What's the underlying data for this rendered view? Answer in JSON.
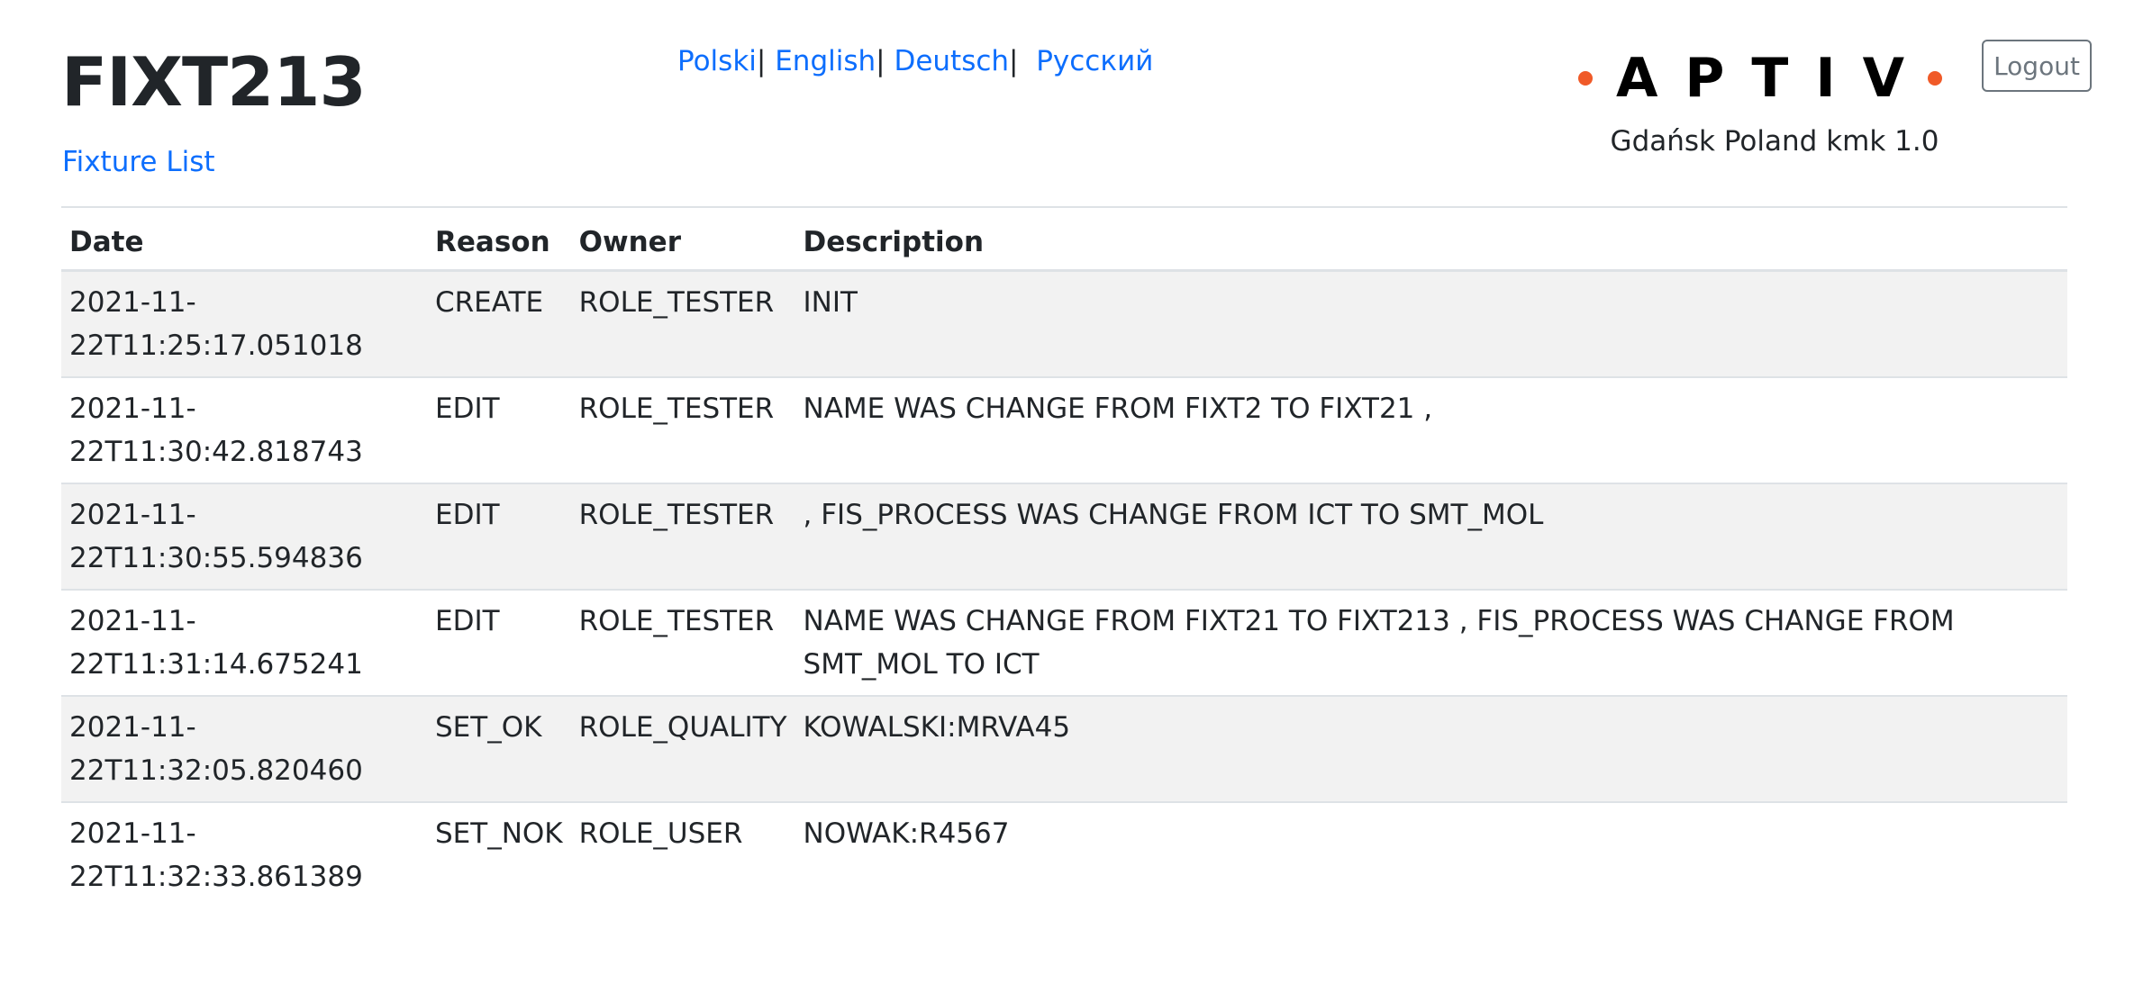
{
  "header": {
    "title": "FIXT213",
    "fixture_list_link": "Fixture List",
    "languages": [
      {
        "label": "Polski"
      },
      {
        "label": "English"
      },
      {
        "label": "Deutsch"
      },
      {
        "label": "Русский"
      }
    ],
    "language_separator": "|",
    "logo_text": "APTIV",
    "site_info": "Gdańsk Poland kmk 1.0",
    "logout_label": "Logout"
  },
  "colors": {
    "link": "#0d6efd",
    "logo_dot": "#f05a28",
    "striped_row": "#f2f2f2",
    "border": "#dee2e6"
  },
  "table": {
    "columns": [
      "Date",
      "Reason",
      "Owner",
      "Description"
    ],
    "rows": [
      {
        "date_line1": "2021-11-",
        "date_line2": "22T11:25:17.051018",
        "reason": "CREATE",
        "owner": "ROLE_TESTER",
        "description": "INIT"
      },
      {
        "date_line1": "2021-11-",
        "date_line2": "22T11:30:42.818743",
        "reason": "EDIT",
        "owner": "ROLE_TESTER",
        "description": "NAME WAS CHANGE FROM FIXT2 TO FIXT21 ,"
      },
      {
        "date_line1": "2021-11-",
        "date_line2": "22T11:30:55.594836",
        "reason": "EDIT",
        "owner": "ROLE_TESTER",
        "description": ", FIS_PROCESS WAS CHANGE FROM ICT TO SMT_MOL"
      },
      {
        "date_line1": "2021-11-",
        "date_line2": "22T11:31:14.675241",
        "reason": "EDIT",
        "owner": "ROLE_TESTER",
        "description": "NAME WAS CHANGE FROM FIXT21 TO FIXT213 , FIS_PROCESS WAS CHANGE FROM SMT_MOL TO ICT"
      },
      {
        "date_line1": "2021-11-",
        "date_line2": "22T11:32:05.820460",
        "reason": "SET_OK",
        "owner": "ROLE_QUALITY",
        "description": "KOWALSKI:MRVA45"
      },
      {
        "date_line1": "2021-11-",
        "date_line2": "22T11:32:33.861389",
        "reason": "SET_NOK",
        "owner": "ROLE_USER",
        "description": "NOWAK:R4567"
      }
    ]
  }
}
